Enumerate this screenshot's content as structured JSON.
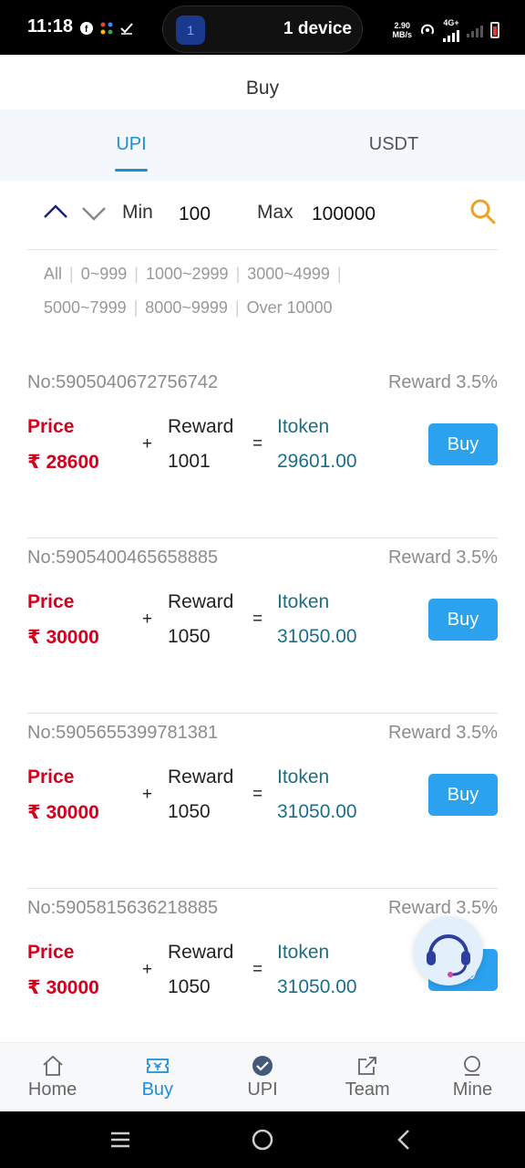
{
  "status_bar": {
    "time": "11:18",
    "left_icons": [
      "facebook-icon",
      "app-grid-icon",
      "check-icon"
    ],
    "pill_badge": "1",
    "pill_text": "1 device",
    "net_speed": "2.90",
    "net_unit": "MB/s",
    "net_type": "4G+"
  },
  "header": {
    "title": "Buy"
  },
  "tabs": [
    {
      "label": "UPI",
      "active": true
    },
    {
      "label": "USDT",
      "active": false
    }
  ],
  "filter": {
    "min_label": "Min",
    "min_value": "100",
    "max_label": "Max",
    "max_value": "100000"
  },
  "ranges": [
    "All",
    "0~999",
    "1000~2999",
    "3000~4999",
    "5000~7999",
    "8000~9999",
    "Over 10000"
  ],
  "orders": [
    {
      "no": "No:5905040672756742",
      "reward_rate": "Reward 3.5%",
      "price_label": "Price",
      "price": "₹ 28600",
      "reward_label": "Reward",
      "reward": "1001",
      "token_label": "Itoken",
      "token": "29601.00",
      "buy_label": "Buy"
    },
    {
      "no": "No:5905400465658885",
      "reward_rate": "Reward 3.5%",
      "price_label": "Price",
      "price": "₹ 30000",
      "reward_label": "Reward",
      "reward": "1050",
      "token_label": "Itoken",
      "token": "31050.00",
      "buy_label": "Buy"
    },
    {
      "no": "No:5905655399781381",
      "reward_rate": "Reward 3.5%",
      "price_label": "Price",
      "price": "₹ 30000",
      "reward_label": "Reward",
      "reward": "1050",
      "token_label": "Itoken",
      "token": "31050.00",
      "buy_label": "Buy"
    },
    {
      "no": "No:5905815636218885",
      "reward_rate": "Reward 3.5%",
      "price_label": "Price",
      "price": "₹ 30000",
      "reward_label": "Reward",
      "reward": "1050",
      "token_label": "Itoken",
      "token": "31050.00",
      "buy_label": "Buy"
    }
  ],
  "operators": {
    "plus": "+",
    "equals": "="
  },
  "bottom_nav": [
    {
      "label": "Home",
      "icon": "home-icon",
      "active": false
    },
    {
      "label": "Buy",
      "icon": "ticket-icon",
      "active": true
    },
    {
      "label": "UPI",
      "icon": "check-circle-icon",
      "active": false
    },
    {
      "label": "Team",
      "icon": "share-icon",
      "active": false
    },
    {
      "label": "Mine",
      "icon": "user-icon",
      "active": false
    }
  ],
  "colors": {
    "accent": "#1a8fd8",
    "price_red": "#d6001c",
    "token_teal": "#1c6e86",
    "buy_button": "#2aa2f0",
    "search_icon": "#f0a020"
  }
}
